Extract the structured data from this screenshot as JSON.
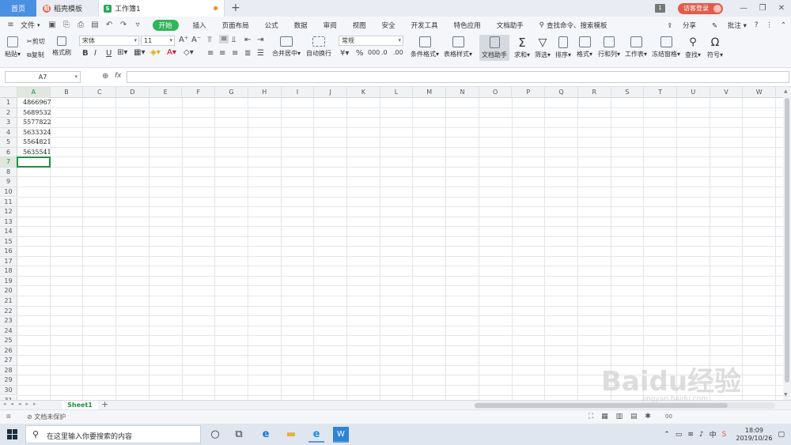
{
  "tabs": {
    "home": "首页",
    "template": "稻壳模板",
    "workbook": "工作簿1",
    "template_icon_letter": "稻",
    "workbook_icon_letter": "S"
  },
  "titlebar": {
    "badge": "1",
    "guest_login": "访客登录"
  },
  "menu": {
    "file": "文件",
    "items": [
      "开始",
      "插入",
      "页面布局",
      "公式",
      "数据",
      "审阅",
      "视图",
      "安全",
      "开发工具",
      "特色应用",
      "文档助手"
    ],
    "search": "查找命令、搜索模板",
    "share": "分享",
    "comment": "批注"
  },
  "ribbon": {
    "paste": "粘贴",
    "cut": "剪切",
    "copy": "复制",
    "format_painter": "格式刷",
    "font_name": "宋体",
    "font_size": "11",
    "merge_center": "合并居中",
    "wrap_text": "自动换行",
    "number_format": "常规",
    "conditional_format": "条件格式",
    "table_style": "表格样式",
    "doc_helper": "文档助手",
    "sum": "求和",
    "filter": "筛选",
    "sort": "排序",
    "format": "格式",
    "row_col": "行和列",
    "worksheet": "工作表",
    "freeze": "冻结窗格",
    "find": "查找",
    "symbol": "符号"
  },
  "formula_bar": {
    "name_box": "A7",
    "fx": "fx",
    "formula": ""
  },
  "columns": [
    "A",
    "B",
    "C",
    "D",
    "E",
    "F",
    "G",
    "H",
    "I",
    "J",
    "K",
    "L",
    "M",
    "N",
    "O",
    "P",
    "Q",
    "R",
    "S",
    "T",
    "U",
    "V",
    "W"
  ],
  "rows": [
    "1",
    "2",
    "3",
    "4",
    "5",
    "6",
    "7",
    "8",
    "9",
    "10",
    "11",
    "12",
    "13",
    "14",
    "15",
    "16",
    "17",
    "18",
    "19",
    "20",
    "21",
    "22",
    "23",
    "24",
    "25",
    "26",
    "27",
    "28",
    "29",
    "30",
    "31"
  ],
  "cells": [
    {
      "ref": "A1",
      "value": "4866967"
    },
    {
      "ref": "A2",
      "value": "5689532"
    },
    {
      "ref": "A3",
      "value": "5577822"
    },
    {
      "ref": "A4",
      "value": "5633324"
    },
    {
      "ref": "A5",
      "value": "5564821"
    },
    {
      "ref": "A6",
      "value": "5635541"
    }
  ],
  "active_cell": "A7",
  "sheet_tab": "Sheet1",
  "status": {
    "protection": "文档未保护",
    "zoom": "00"
  },
  "taskbar": {
    "search_placeholder": "在这里输入你要搜索的内容",
    "ime": "中",
    "time": "18:09",
    "date": "2019/10/26"
  },
  "watermark": {
    "main": "Baidu经验",
    "sub": "jingyan.baidu.com"
  },
  "colors": {
    "accent_green": "#2fb55a",
    "active_border": "#1f8f3f",
    "home_tab": "#4a90e2",
    "guest_button": "#e05c4b"
  }
}
